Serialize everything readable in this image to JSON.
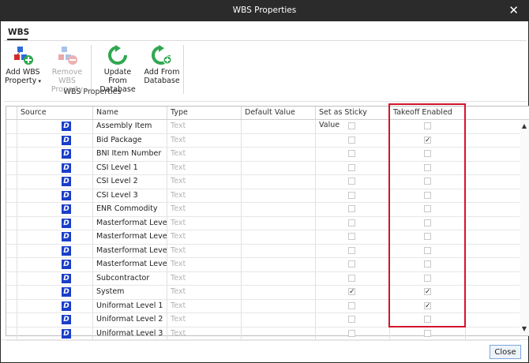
{
  "window": {
    "title": "WBS Properties"
  },
  "ribbon": {
    "tab": "WBS",
    "buttons": [
      {
        "label_line1": "Add WBS",
        "label_line2": "Property",
        "icon": "add-wbs-property-icon",
        "enabled": true,
        "dropdown": true
      },
      {
        "label_line1": "Remove WBS",
        "label_line2": "Property",
        "icon": "remove-wbs-property-icon",
        "enabled": false
      },
      {
        "label_line1": "Update From",
        "label_line2": "Database",
        "icon": "refresh-icon",
        "enabled": true
      },
      {
        "label_line1": "Add From",
        "label_line2": "Database",
        "icon": "add-refresh-icon",
        "enabled": true
      }
    ],
    "group_label": "WBS Properties"
  },
  "grid": {
    "columns": [
      "Source",
      "Name",
      "Type",
      "Default Value",
      "Set as Sticky Value",
      "Takeoff Enabled"
    ],
    "rows": [
      {
        "source": "D",
        "name": "Assembly Item",
        "type": "Text",
        "default": "",
        "sticky": false,
        "takeoff": false
      },
      {
        "source": "D",
        "name": "Bid Package",
        "type": "Text",
        "default": "",
        "sticky": false,
        "takeoff": true
      },
      {
        "source": "D",
        "name": "BNI Item Number",
        "type": "Text",
        "default": "",
        "sticky": false,
        "takeoff": false
      },
      {
        "source": "D",
        "name": "CSI Level 1",
        "type": "Text",
        "default": "",
        "sticky": false,
        "takeoff": false
      },
      {
        "source": "D",
        "name": "CSI Level 2",
        "type": "Text",
        "default": "",
        "sticky": false,
        "takeoff": false
      },
      {
        "source": "D",
        "name": "CSI Level 3",
        "type": "Text",
        "default": "",
        "sticky": false,
        "takeoff": false
      },
      {
        "source": "D",
        "name": "ENR Commodity",
        "type": "Text",
        "default": "",
        "sticky": false,
        "takeoff": false
      },
      {
        "source": "D",
        "name": "Masterformat Level...",
        "type": "Text",
        "default": "",
        "sticky": false,
        "takeoff": false
      },
      {
        "source": "D",
        "name": "Masterformat Level...",
        "type": "Text",
        "default": "",
        "sticky": false,
        "takeoff": false
      },
      {
        "source": "D",
        "name": "Masterformat Level...",
        "type": "Text",
        "default": "",
        "sticky": false,
        "takeoff": false
      },
      {
        "source": "D",
        "name": "Masterformat Level...",
        "type": "Text",
        "default": "",
        "sticky": false,
        "takeoff": false
      },
      {
        "source": "D",
        "name": "Subcontractor",
        "type": "Text",
        "default": "",
        "sticky": false,
        "takeoff": false
      },
      {
        "source": "D",
        "name": "System",
        "type": "Text",
        "default": "",
        "sticky": true,
        "takeoff": true
      },
      {
        "source": "D",
        "name": "Uniformat Level 1",
        "type": "Text",
        "default": "",
        "sticky": false,
        "takeoff": true
      },
      {
        "source": "D",
        "name": "Uniformat Level 2",
        "type": "Text",
        "default": "",
        "sticky": false,
        "takeoff": false
      },
      {
        "source": "D",
        "name": "Uniformat Level 3",
        "type": "Text",
        "default": "",
        "sticky": false,
        "takeoff": false
      }
    ]
  },
  "footer": {
    "close_label": "Close"
  },
  "colors": {
    "titlebar": "#2b2b2b",
    "highlight": "#d4142a",
    "source_icon": "#1a3ec8"
  }
}
